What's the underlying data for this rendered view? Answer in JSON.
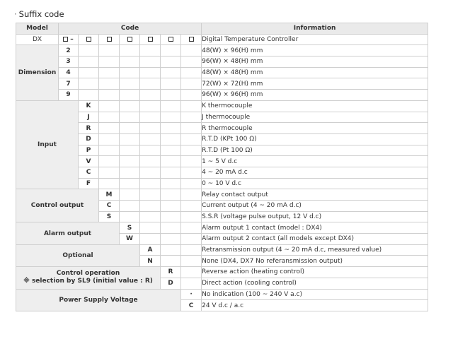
{
  "title": "Suffix code",
  "header": {
    "model": "Model",
    "code": "Code",
    "information": "Information"
  },
  "model_row": {
    "model": "DX",
    "first_box_suffix": "–",
    "information": "Digital Temperature Controller"
  },
  "groups": {
    "dimension": {
      "label": "Dimension",
      "rows": [
        {
          "code": "2",
          "info": "48(W) × 96(H) mm"
        },
        {
          "code": "3",
          "info": "96(W) × 48(H) mm"
        },
        {
          "code": "4",
          "info": "48(W) × 48(H) mm"
        },
        {
          "code": "7",
          "info": "72(W) × 72(H) mm"
        },
        {
          "code": "9",
          "info": "96(W) × 96(H) mm"
        }
      ]
    },
    "input": {
      "label": "Input",
      "rows": [
        {
          "code": "K",
          "info": "K thermocouple"
        },
        {
          "code": "J",
          "info": "J thermocouple"
        },
        {
          "code": "R",
          "info": "R thermocouple"
        },
        {
          "code": "D",
          "info": "R.T.D (KPt 100 Ω)"
        },
        {
          "code": "P",
          "info": "R.T.D (Pt 100 Ω)"
        },
        {
          "code": "V",
          "info": "1 ~ 5 V d.c"
        },
        {
          "code": "C",
          "info": "4 ~ 20 mA d.c"
        },
        {
          "code": "F",
          "info": "0 ~ 10 V d.c"
        }
      ]
    },
    "control_output": {
      "label": "Control output",
      "rows": [
        {
          "code": "M",
          "info": "Relay contact output"
        },
        {
          "code": "C",
          "info": "Current output (4 ~ 20 mA d.c)"
        },
        {
          "code": "S",
          "info": "S.S.R (voltage pulse output, 12 V d.c)"
        }
      ]
    },
    "alarm_output": {
      "label": "Alarm output",
      "rows": [
        {
          "code": "S",
          "info": "Alarm output 1 contact (model : DX4)"
        },
        {
          "code": "W",
          "info": "Alarm output 2 contact (all models except DX4)"
        }
      ]
    },
    "optional": {
      "label": "Optional",
      "rows": [
        {
          "code": "A",
          "info": "Retransmission output (4 ~ 20 mA d.c, measured value)"
        },
        {
          "code": "N",
          "info": "None (DX4, DX7 No referansmission output)"
        }
      ]
    },
    "control_operation": {
      "label": "Control operation",
      "note": "※ selection by SL9 (initial value : R)",
      "rows": [
        {
          "code": "R",
          "info": "Reverse action (heating control)"
        },
        {
          "code": "D",
          "info": "Direct action (cooling control)"
        }
      ]
    },
    "power_supply": {
      "label": "Power Supply Voltage",
      "rows": [
        {
          "code": "·",
          "info": "No indication (100 ~ 240 V a.c)"
        },
        {
          "code": "C",
          "info": "24 V d.c / a.c"
        }
      ]
    }
  }
}
